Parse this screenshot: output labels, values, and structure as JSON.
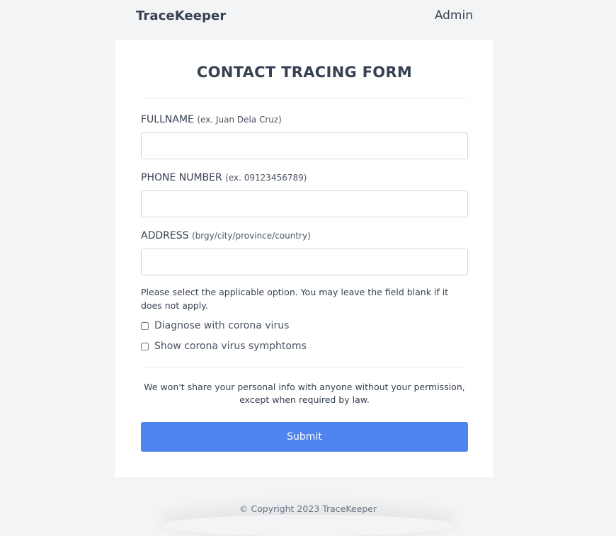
{
  "navbar": {
    "brand": "TraceKeeper",
    "admin_label": "Admin"
  },
  "form": {
    "title": "CONTACT TRACING FORM",
    "fields": [
      {
        "label": "FULLNAME",
        "hint": "(ex. Juan Dela Cruz)",
        "value": "",
        "placeholder": ""
      },
      {
        "label": "PHONE NUMBER",
        "hint": "(ex. 09123456789)",
        "value": "",
        "placeholder": ""
      },
      {
        "label": "ADDRESS",
        "hint": "(brgy/city/province/country)",
        "value": "",
        "placeholder": ""
      }
    ],
    "options_note": "Please select the applicable option. You may leave the field blank if it does not apply.",
    "options": [
      {
        "label": "Diagnose with corona virus",
        "checked": false
      },
      {
        "label": "Show corona virus symphtoms",
        "checked": false
      }
    ],
    "privacy_note": "We won't share your personal info with anyone without your permission, except when required by law.",
    "submit_label": "Submit"
  },
  "footer": {
    "copyright": "© Copyright 2023 TraceKeeper"
  }
}
